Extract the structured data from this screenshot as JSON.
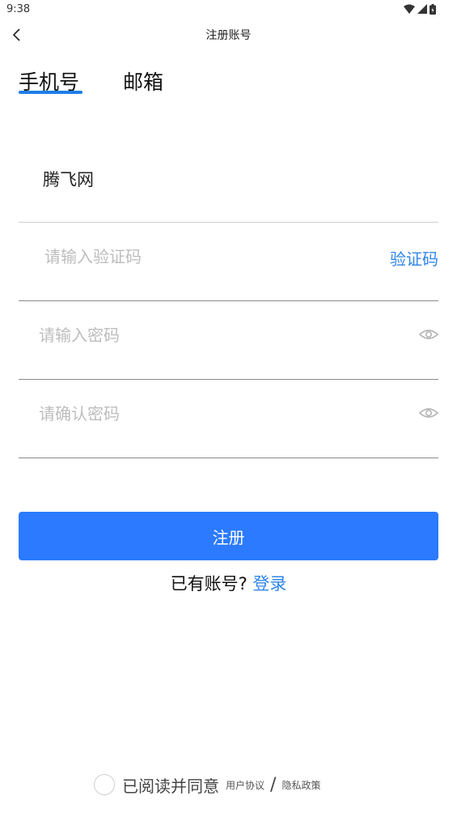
{
  "status_bar": {
    "time": "9:38"
  },
  "appbar": {
    "title": "注册账号",
    "back_icon": "chevron-left-icon"
  },
  "tabs": [
    {
      "label": "手机号",
      "active": true
    },
    {
      "label": "邮箱",
      "active": false
    }
  ],
  "form": {
    "account_value": "腾飞网",
    "code_placeholder": "请输入验证码",
    "code_button": "验证码",
    "password_placeholder": "请输入密码",
    "confirm_placeholder": "请确认密码"
  },
  "register_button": "注册",
  "login_prompt": "已有账号?",
  "login_link": "登录",
  "agreement": {
    "text": "已阅读并同意",
    "user_agreement": "用户协议",
    "separator": "/",
    "privacy_policy": "隐私政策"
  },
  "colors": {
    "accent": "#2b7aff",
    "link": "#2f86e8",
    "tab_underline": "#1e7ee8"
  }
}
